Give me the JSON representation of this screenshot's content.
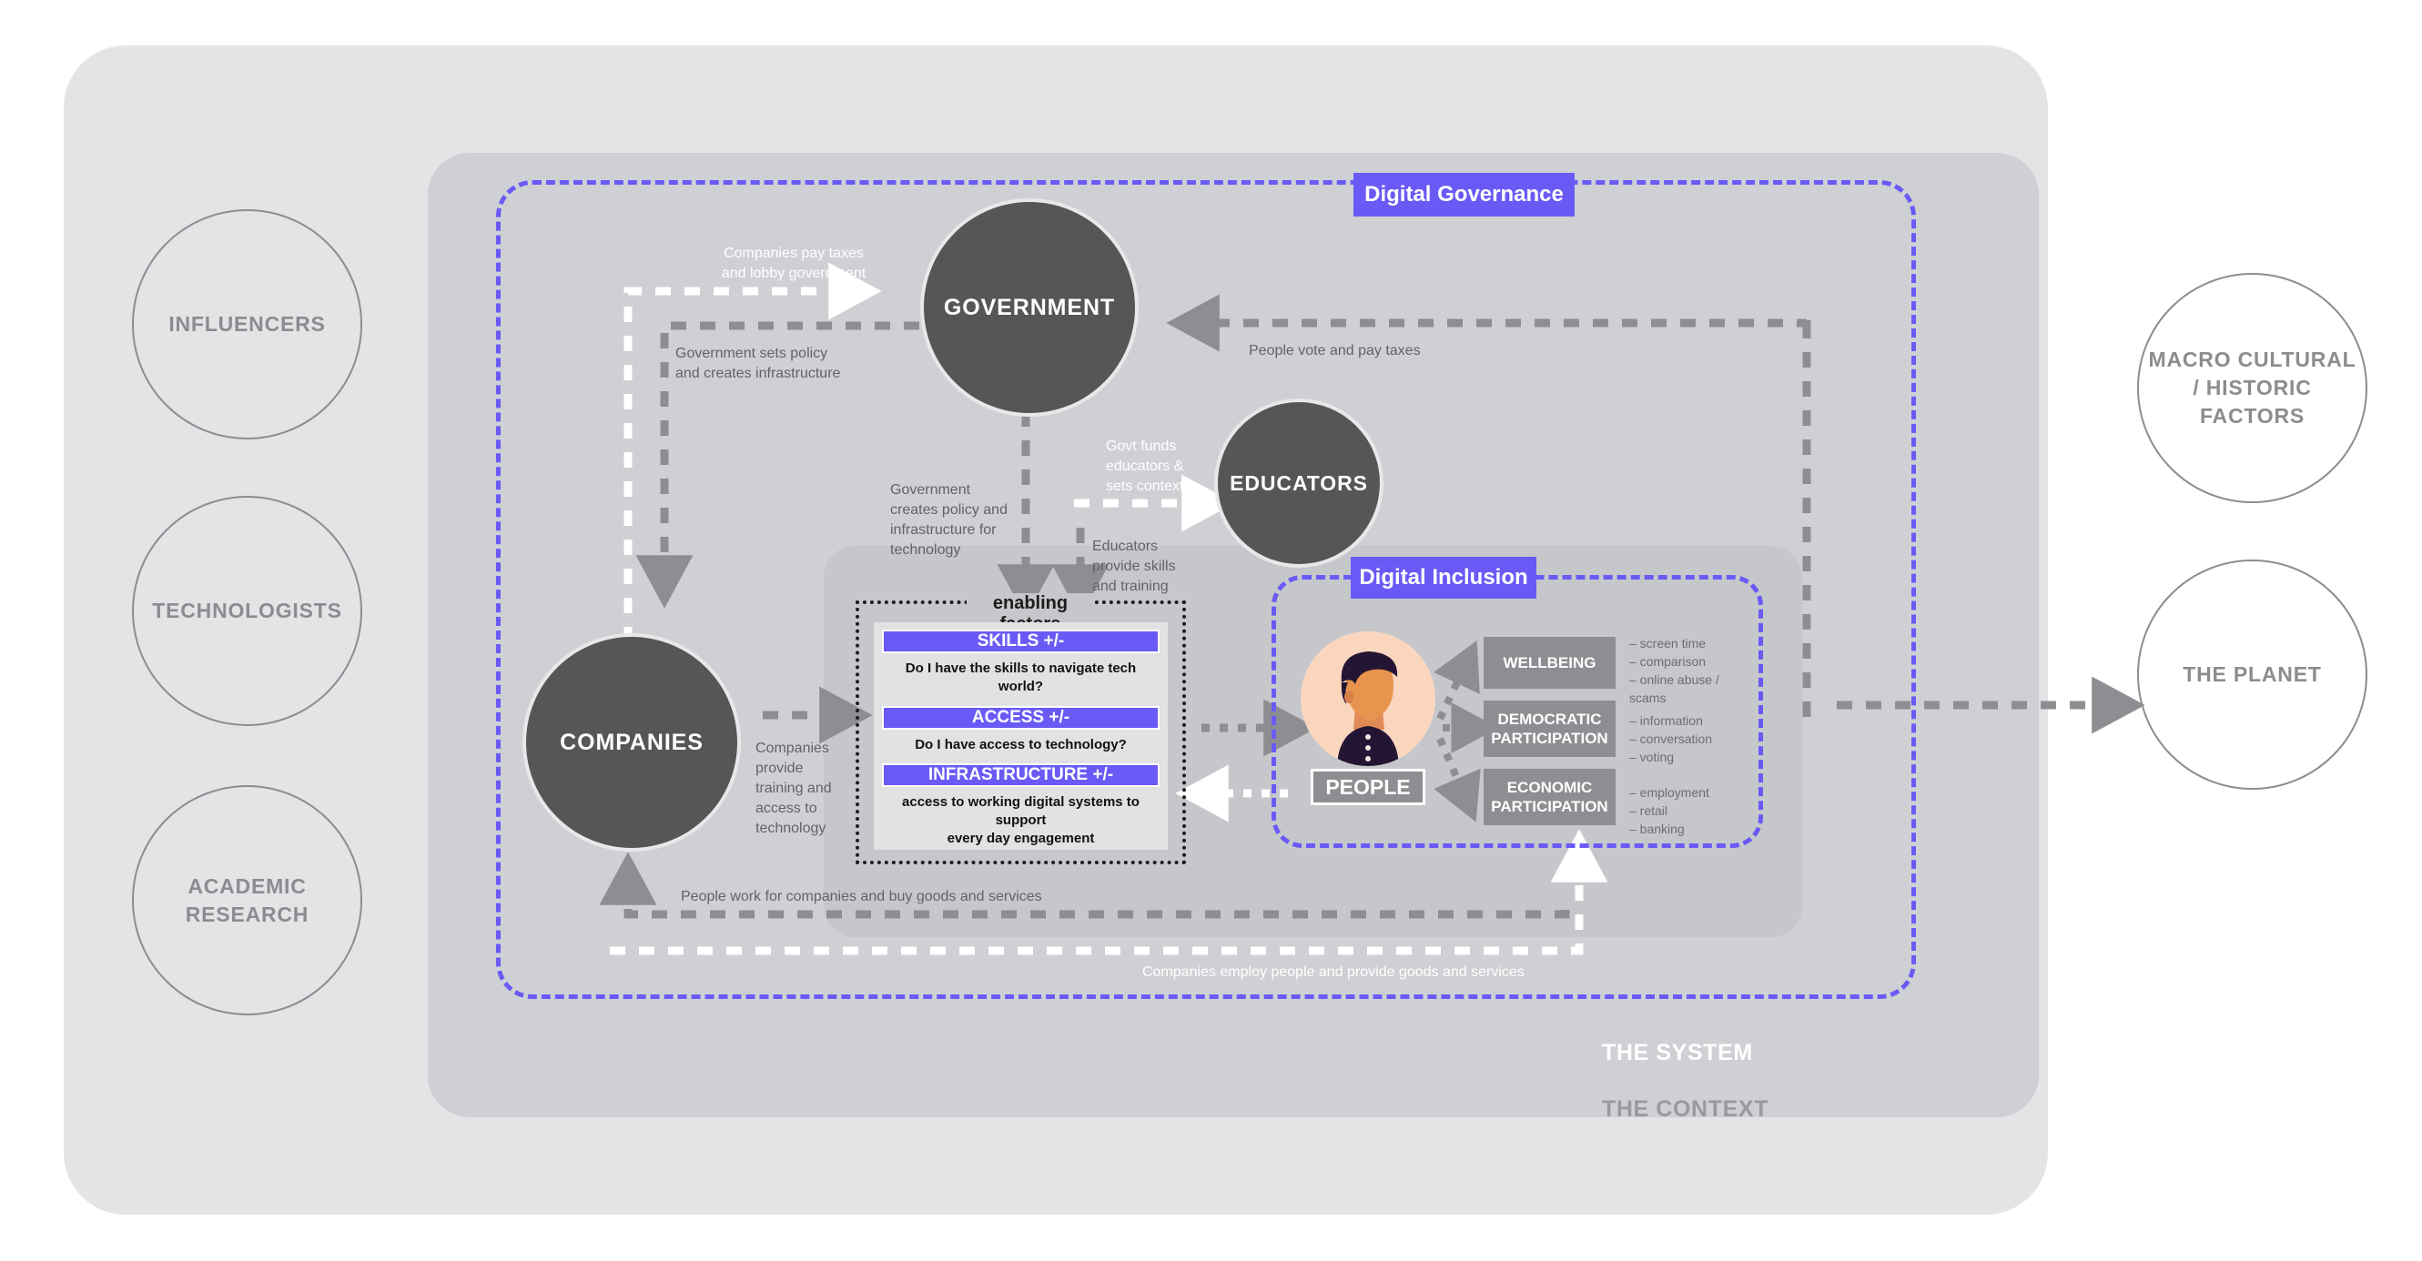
{
  "panels": {
    "context_label": "THE CONTEXT",
    "system_label": "THE SYSTEM"
  },
  "outer_circles": [
    {
      "name": "influencers",
      "label": "INFLUENCERS"
    },
    {
      "name": "technologists",
      "label": "TECHNOLOGISTS"
    },
    {
      "name": "academic-research",
      "label": "ACADEMIC\nRESEARCH"
    },
    {
      "name": "macro-cultural-historic-factors",
      "label": "MACRO CULTURAL\n/ HISTORIC\nFACTORS"
    },
    {
      "name": "the-planet",
      "label": "THE PLANET"
    }
  ],
  "actors": {
    "government": "GOVERNMENT",
    "educators": "EDUCATORS",
    "companies": "COMPANIES",
    "people": "PEOPLE"
  },
  "loops": {
    "digital_governance": "Digital Governance",
    "digital_inclusion": "Digital Inclusion"
  },
  "enabling_factors": {
    "title": "enabling factors",
    "items": [
      {
        "bar": "SKILLS +/-",
        "question": "Do I have the skills to navigate tech world?"
      },
      {
        "bar": "ACCESS +/-",
        "question": "Do I have access to technology?"
      },
      {
        "bar": "INFRASTRUCTURE +/-",
        "question": "access to working digital systems to support\nevery day engagement"
      }
    ]
  },
  "outcomes": [
    {
      "label": "WELLBEING",
      "details": "– screen time\n– comparison\n– online abuse /\nscams"
    },
    {
      "label": "DEMOCRATIC\nPARTICIPATION",
      "details": "– information\n– conversation\n– voting"
    },
    {
      "label": "ECONOMIC\nPARTICIPATION",
      "details": "– employment\n– retail\n– banking"
    }
  ],
  "flows": {
    "companies_pay_taxes": "Companies pay taxes\nand lobby government",
    "government_sets_policy": "Government sets policy\nand creates infrastructure",
    "people_vote": "People vote and pay taxes",
    "govt_funds_educators": "Govt funds\neducators &\nsets context",
    "government_creates_policy": "Government\ncreates policy and\ninfrastructure for\ntechnology",
    "educators_provide_skills": "Educators\nprovide skills\nand training",
    "companies_provide_training": "Companies\nprovide\ntraining and\naccess to\ntechnology",
    "people_work_for_companies": "People work for companies and buy goods and services",
    "companies_employ_people": "Companies employ people and provide goods and services"
  },
  "colors": {
    "accent_purple": "#6a5af5",
    "actor_dark": "#565656",
    "outcome_grey": "#8e8e92",
    "context_bg": "#e3e4e6",
    "system_bg": "#cfd0d4"
  }
}
